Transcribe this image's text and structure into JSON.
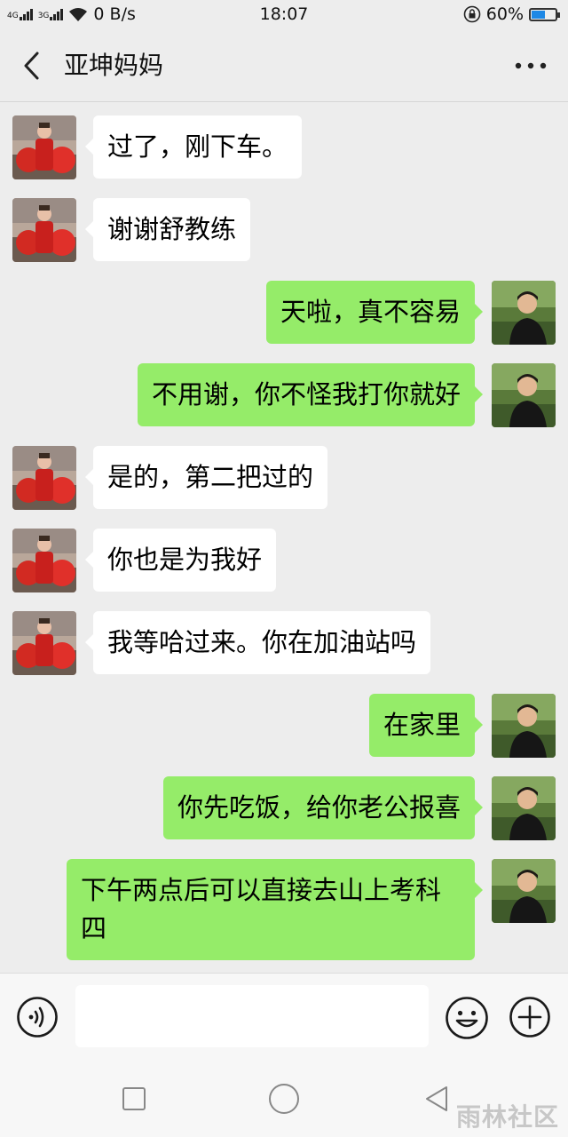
{
  "status_bar": {
    "network_1": "4G",
    "network_2": "3G",
    "speed": "0 B/s",
    "time": "18:07",
    "battery": "60%",
    "battery_level": 0.6,
    "battery_color": "#1e88e5"
  },
  "header": {
    "title": "亚坤妈妈",
    "back_icon": "chevron-left-icon",
    "more_icon": "more-dots-icon"
  },
  "colors": {
    "background": "#ededed",
    "bubble_sent": "#95ec69",
    "bubble_received": "#ffffff"
  },
  "messages": [
    {
      "side": "left",
      "text": "过了，刚下车。"
    },
    {
      "side": "left",
      "text": "谢谢舒教练"
    },
    {
      "side": "right",
      "text": "天啦，真不容易"
    },
    {
      "side": "right",
      "text": "不用谢，你不怪我打你就好"
    },
    {
      "side": "left",
      "text": "是的，第二把过的"
    },
    {
      "side": "left",
      "text": "你也是为我好"
    },
    {
      "side": "left",
      "text": "我等哈过来。你在加油站吗"
    },
    {
      "side": "right",
      "text": "在家里"
    },
    {
      "side": "right",
      "text": "你先吃饭，给你老公报喜"
    },
    {
      "side": "right",
      "text": "下午两点后可以直接去山上考科四"
    }
  ],
  "input_bar": {
    "value": "",
    "voice_icon": "voice-icon",
    "emoji_icon": "emoji-icon",
    "plus_icon": "plus-icon"
  },
  "nav_bar": {
    "recent_icon": "recent-apps-icon",
    "home_icon": "home-icon",
    "back_icon": "back-triangle-icon"
  },
  "watermark": "雨林社区"
}
